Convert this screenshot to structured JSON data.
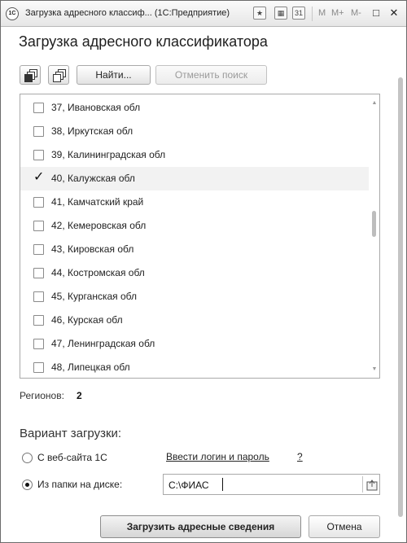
{
  "window": {
    "logo_text": "1С",
    "title": "Загрузка адресного классиф...  (1С:Предприятие)",
    "toolbar_icons": [
      "favorite-star-icon",
      "calculator-icon",
      "calendar-icon"
    ],
    "calendar_glyph": "31",
    "memory_buttons": [
      "M",
      "M+",
      "M-"
    ],
    "controls": {
      "restore": "□",
      "close": "✕"
    }
  },
  "form": {
    "heading": "Загрузка адресного классификатора",
    "toolbar": {
      "check_all_icon": "check-all-icon",
      "uncheck_all_icon": "uncheck-all-icon",
      "find_label": "Найти...",
      "cancel_search_label": "Отменить поиск"
    },
    "regions": [
      {
        "label": "37, Ивановская обл",
        "checked": false
      },
      {
        "label": "38, Иркутская обл",
        "checked": false
      },
      {
        "label": "39, Калининградская обл",
        "checked": false
      },
      {
        "label": "40, Калужская обл",
        "checked": true
      },
      {
        "label": "41, Камчатский край",
        "checked": false
      },
      {
        "label": "42, Кемеровская обл",
        "checked": false
      },
      {
        "label": "43, Кировская обл",
        "checked": false
      },
      {
        "label": "44, Костромская обл",
        "checked": false
      },
      {
        "label": "45, Курганская обл",
        "checked": false
      },
      {
        "label": "46, Курская обл",
        "checked": false
      },
      {
        "label": "47, Ленинградская обл",
        "checked": false
      },
      {
        "label": "48, Липецкая обл",
        "checked": false
      }
    ],
    "selected_row": 3,
    "regions_label": "Регионов:",
    "regions_count": "2",
    "variant_title": "Вариант загрузки:",
    "option_web": {
      "label": "С веб-сайта 1С",
      "selected": false
    },
    "login_link": "Ввести логин и пароль",
    "help_link": "?",
    "option_folder": {
      "label": "Из папки на диске:",
      "selected": true
    },
    "folder_path": "C:\\ФИАС",
    "load_button": "Загрузить адресные сведения",
    "cancel_button": "Отмена"
  }
}
